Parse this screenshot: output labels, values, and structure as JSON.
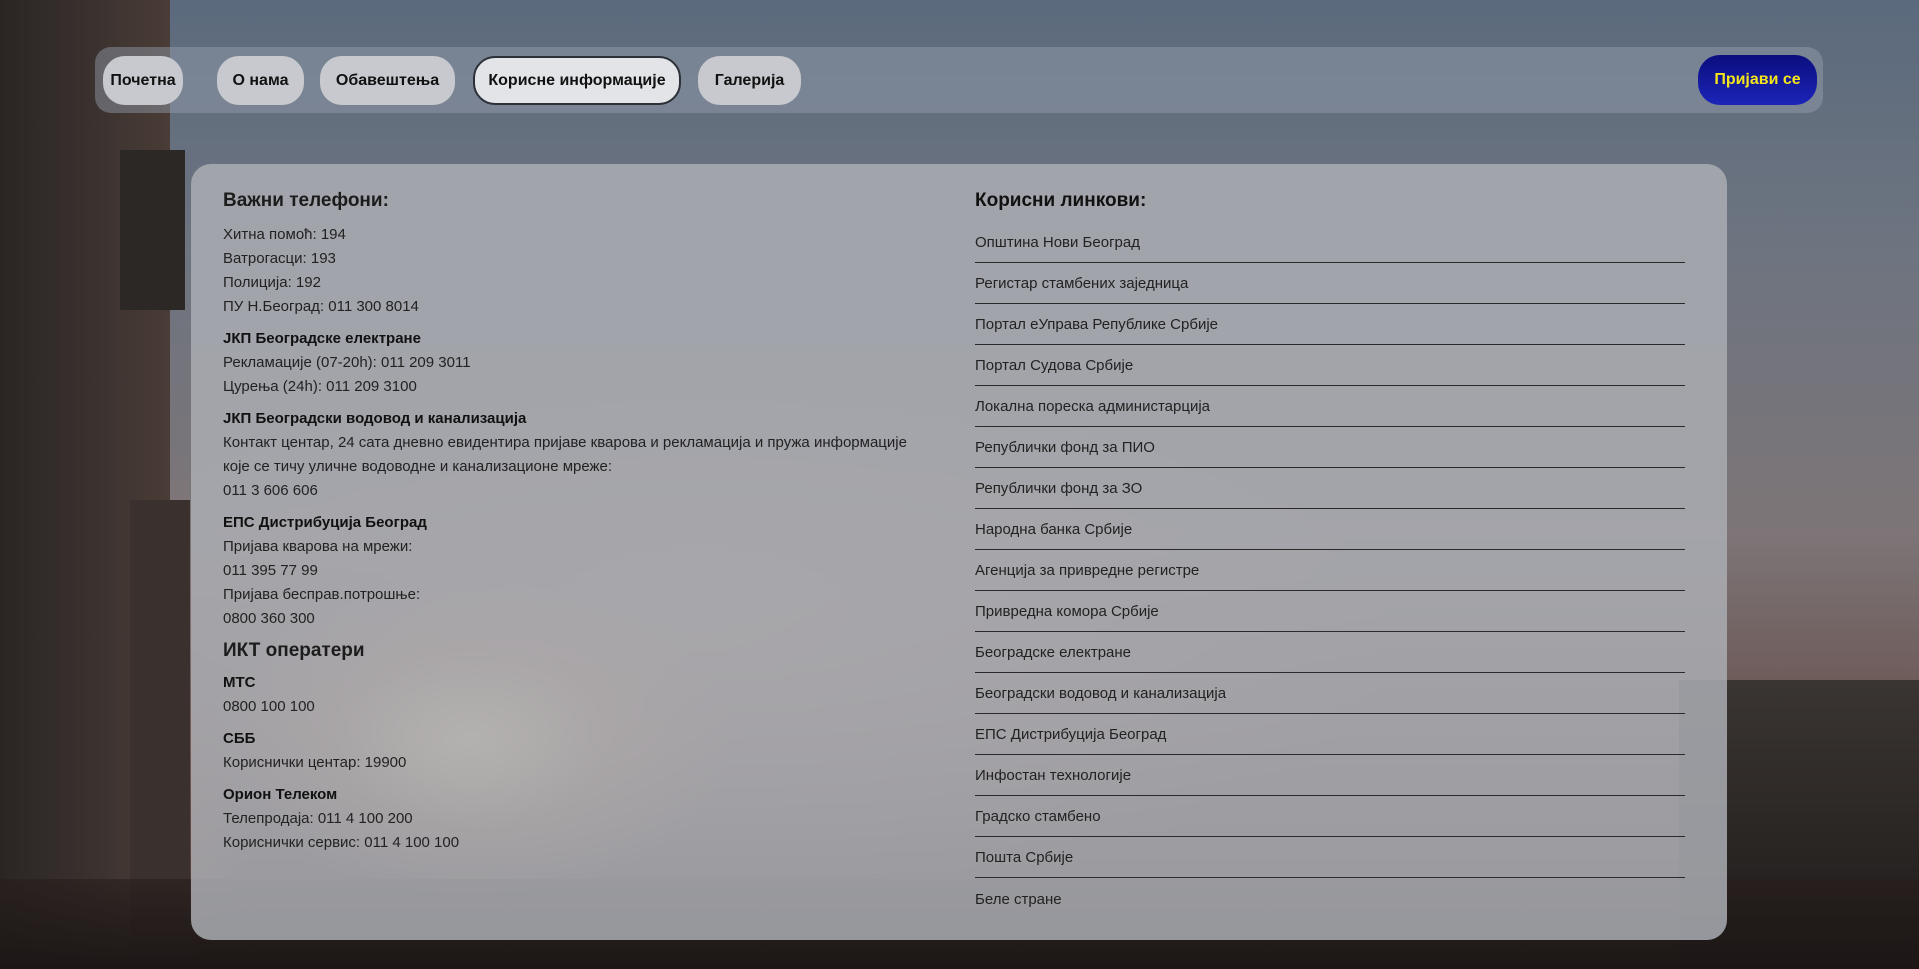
{
  "nav": {
    "items": [
      {
        "label": "Почетна"
      },
      {
        "label": "О нама"
      },
      {
        "label": "Обавештења"
      },
      {
        "label": "Корисне информације"
      },
      {
        "label": "Галерија"
      }
    ],
    "login_label": "Пријави се"
  },
  "phones": {
    "title": "Важни телефони:",
    "general": [
      "Хитна помоћ: 194",
      "Ватрогасци: 193",
      "Полиција: 192",
      "ПУ Н.Београд: 011 300 8014"
    ],
    "power": {
      "name": "ЈКП Београдске електране",
      "lines": [
        "Рекламације (07-20h): 011 209 3011",
        "Цурења (24h): 011 209 3100"
      ]
    },
    "water": {
      "name": "ЈКП Београдски водовод и канализација",
      "lines": [
        "Контакт центар, 24 сата дневно евидентира пријаве кварова и рекламација и пружа информације",
        "које се тичу уличне водоводне и канализационе мреже:",
        "011 3 606 606"
      ]
    },
    "eps": {
      "name": "ЕПС Дистрибуција Београд",
      "lines": [
        "Пријава кварова на мрежи:",
        "011 395 77 99",
        "Пријава бесправ.потрошње:",
        "0800 360 300"
      ]
    },
    "ikt_title": "ИКТ оператери",
    "mts": {
      "name": "МТС",
      "lines": [
        "0800 100 100"
      ]
    },
    "sbb": {
      "name": "СББ",
      "lines": [
        "Кориснички центар: 19900"
      ]
    },
    "orion": {
      "name": "Орион Телеком",
      "lines": [
        "Телепродаја: 011 4 100 200",
        "Кориснички сервис: 011 4 100 100"
      ]
    }
  },
  "links": {
    "title": "Корисни линкови:",
    "items": [
      "Општина Нови Београд",
      "Регистар стамбених заједница",
      "Портал еУправа Републике Србије",
      "Портал Судова Србије",
      "Локална пореска администарција",
      "Републички фонд за ПИО",
      "Републички фонд за ЗО",
      "Народна банка Србије",
      "Агенција за привредне регистре",
      "Привредна комора Србије",
      "Београдске електране",
      "Београдски водовод и канализација",
      "ЕПС Дистрибуција Београд",
      "Инфостан технологије",
      "Градско стамбено",
      "Пошта Србије",
      "Беле стране"
    ]
  }
}
